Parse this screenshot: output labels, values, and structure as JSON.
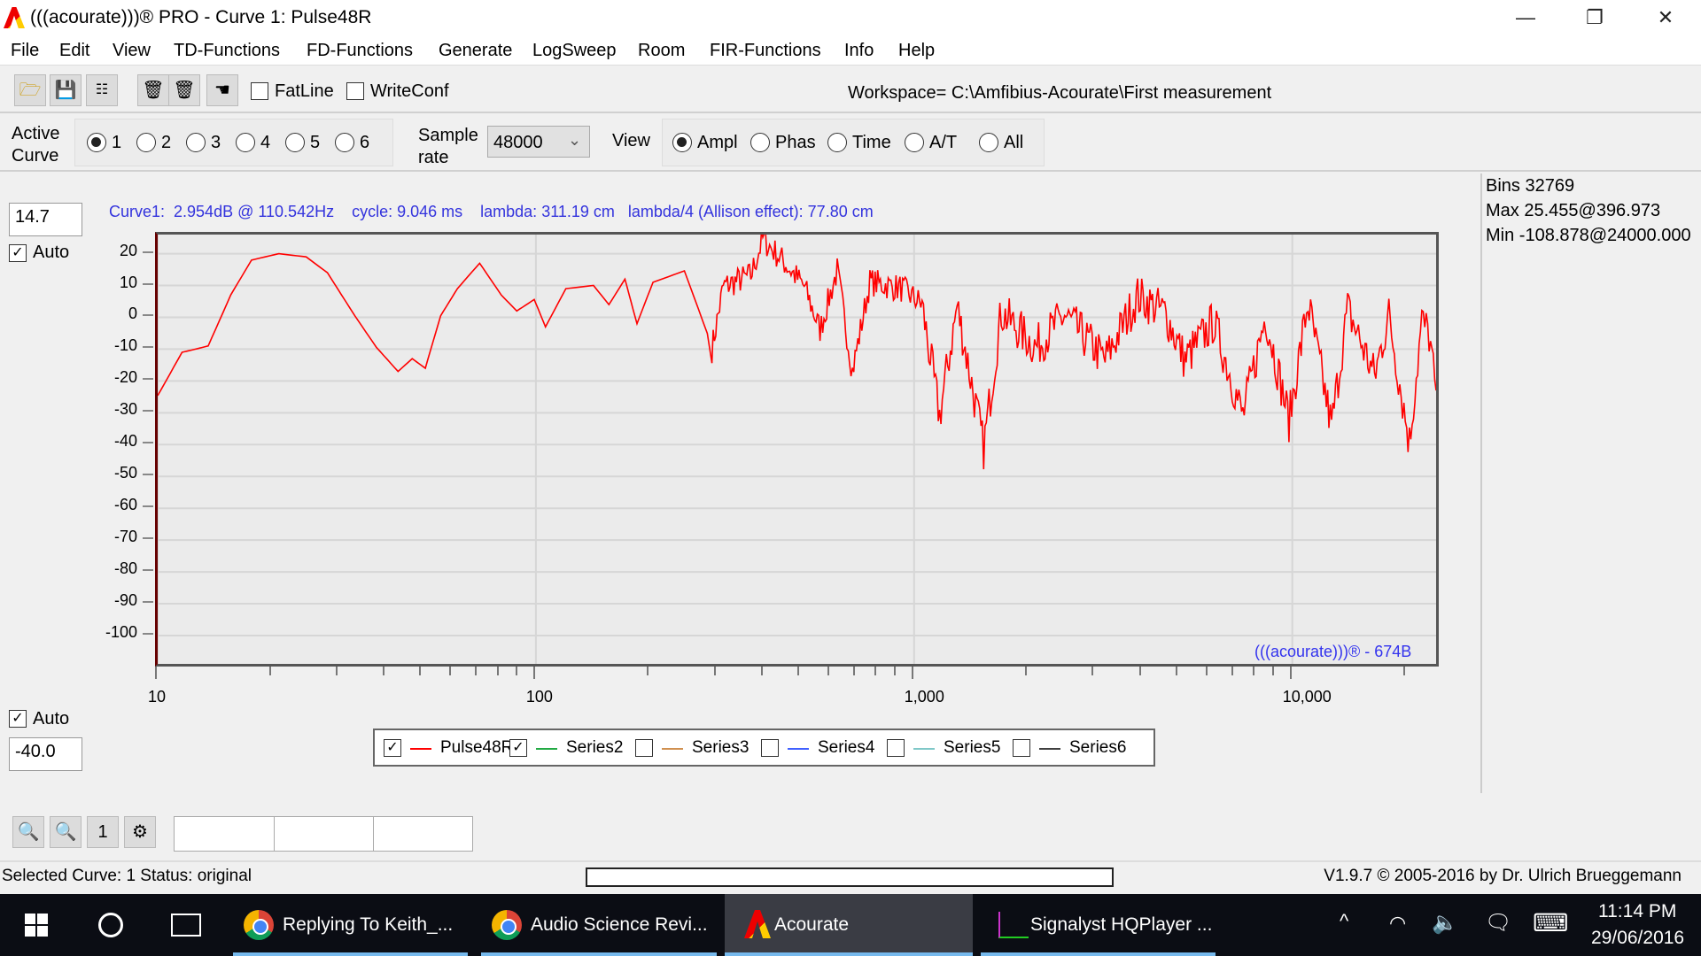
{
  "window": {
    "title": "(((acourate)))® PRO - Curve 1: Pulse48R",
    "minimize": "—",
    "restore": "❐",
    "close": "✕"
  },
  "menu": [
    "File",
    "Edit",
    "View",
    "TD-Functions",
    "FD-Functions",
    "Generate",
    "LogSweep",
    "Room",
    "FIR-Functions",
    "Info",
    "Help"
  ],
  "toolbar": {
    "fatline": "FatLine",
    "writeconf": "WriteConf",
    "fatline_checked": false,
    "writeconf_checked": false,
    "workspace": "Workspace= C:\\Amfibius-Acourate\\First measurement",
    "icons": [
      "folder-open-icon",
      "save-icon",
      "tree-icon",
      "delete-all-icon",
      "delete-icon",
      "pointing-hand-icon"
    ]
  },
  "curve_row": {
    "active_label_1": "Active",
    "active_label_2": "Curve",
    "curves": [
      "1",
      "2",
      "3",
      "4",
      "5",
      "6"
    ],
    "selected_curve": "1",
    "sample_label_1": "Sample",
    "sample_label_2": "rate",
    "sample_rate": "48000",
    "view_label": "View",
    "views": [
      "Ampl",
      "Phas",
      "Time",
      "A/T",
      "All"
    ],
    "selected_view": "Ampl"
  },
  "info_line": "Curve1:  2.954dB @ 110.542Hz    cycle: 9.046 ms    lambda: 311.19 cm   lambda/4 (Allison effect): 77.80 cm",
  "right_panel": {
    "bins": "Bins 32769",
    "max": "Max 25.455@396.973",
    "min": "Min -108.878@24000.000"
  },
  "y_top": {
    "value": "14.7",
    "auto": "Auto",
    "auto_checked": true
  },
  "y_bottom": {
    "value": "-40.0",
    "auto": "Auto",
    "auto_checked": true
  },
  "watermark": "(((acourate)))® - 674B",
  "chart_data": {
    "type": "line",
    "x_scale": "log",
    "xlim": [
      10,
      24000
    ],
    "ylim": [
      -108.9,
      26
    ],
    "grid": true,
    "xticks": [
      {
        "v": 10,
        "label": "10"
      },
      {
        "v": 100,
        "label": "100"
      },
      {
        "v": 1000,
        "label": "1,000"
      },
      {
        "v": 10000,
        "label": "10,000"
      }
    ],
    "yticks": [
      20,
      10,
      0,
      -10,
      -20,
      -30,
      -40,
      -50,
      -60,
      -70,
      -80,
      -90,
      -100
    ],
    "series": [
      {
        "name": "Pulse48R",
        "color": "#ff0000",
        "points": [
          [
            10,
            -24.6
          ],
          [
            11.6,
            -11
          ],
          [
            12.6,
            -10
          ],
          [
            13.6,
            -9
          ],
          [
            15.6,
            7
          ],
          [
            17.7,
            18
          ],
          [
            20.9,
            20
          ],
          [
            24.7,
            19
          ],
          [
            28.1,
            14
          ],
          [
            33.2,
            0.5
          ],
          [
            37.9,
            -9.5
          ],
          [
            43.2,
            -17
          ],
          [
            47.1,
            -13
          ],
          [
            51,
            -16
          ],
          [
            56,
            0.5
          ],
          [
            62,
            9
          ],
          [
            71,
            17
          ],
          [
            81,
            7
          ],
          [
            89,
            2
          ],
          [
            99,
            5.6
          ],
          [
            106,
            -3
          ],
          [
            120,
            9
          ],
          [
            142,
            10
          ],
          [
            156,
            4
          ],
          [
            172,
            12
          ],
          [
            185,
            -2
          ],
          [
            204,
            11
          ],
          [
            247,
            14.6
          ],
          [
            292,
            -9
          ],
          [
            313,
            10.6
          ],
          [
            370,
            14
          ],
          [
            398,
            25.5
          ],
          [
            447,
            19
          ],
          [
            512,
            10.6
          ],
          [
            564,
            -3
          ],
          [
            626,
            15.6
          ],
          [
            687,
            -16
          ],
          [
            764,
            12
          ],
          [
            925,
            10
          ],
          [
            1050,
            5
          ],
          [
            1168,
            -29.7
          ],
          [
            1300,
            5
          ],
          [
            1527,
            -39.7
          ],
          [
            1700,
            3
          ],
          [
            2100,
            -8
          ],
          [
            2500,
            2
          ],
          [
            3200,
            -12
          ],
          [
            3900,
            8
          ],
          [
            4600,
            3
          ],
          [
            5200,
            -12
          ],
          [
            6200,
            0
          ],
          [
            7400,
            -29.7
          ],
          [
            8500,
            2
          ],
          [
            9800,
            -31
          ],
          [
            11000,
            6
          ],
          [
            12700,
            -33
          ],
          [
            14000,
            4
          ],
          [
            16500,
            -17
          ],
          [
            18000,
            2
          ],
          [
            20400,
            -38
          ],
          [
            22000,
            0
          ],
          [
            23000,
            -4
          ],
          [
            24000,
            -23
          ]
        ]
      }
    ]
  },
  "legend": [
    {
      "name": "Pulse48R",
      "color": "#ff0000",
      "checked": true
    },
    {
      "name": "Series2",
      "color": "#22aa44",
      "checked": true
    },
    {
      "name": "Series3",
      "color": "#d09050",
      "checked": false
    },
    {
      "name": "Series4",
      "color": "#4060ff",
      "checked": false
    },
    {
      "name": "Series5",
      "color": "#80c8c8",
      "checked": false
    },
    {
      "name": "Series6",
      "color": "#404040",
      "checked": false
    }
  ],
  "bottom_toolbar": {
    "zoom_reset": "1",
    "icons": [
      "zoom-in-icon",
      "zoom-out-icon",
      "target-icon"
    ]
  },
  "status": {
    "left": "Selected Curve: 1   Status: original",
    "right": "V1.9.7 © 2005-2016 by Dr. Ulrich Brueggemann"
  },
  "taskbar": {
    "items": [
      {
        "label": "Replying To Keith_..."
      },
      {
        "label": "Audio Science Revi..."
      },
      {
        "label": "Acourate"
      },
      {
        "label": "Signalyst HQPlayer ..."
      }
    ],
    "time": "11:14 PM",
    "date": "29/06/2016"
  }
}
